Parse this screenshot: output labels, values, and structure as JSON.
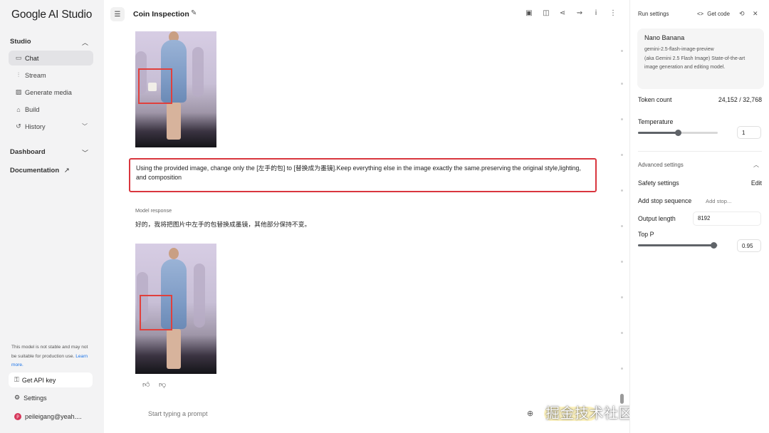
{
  "sidebar": {
    "logo": "Google AI Studio",
    "studio_label": "Studio",
    "items": [
      {
        "label": "Chat",
        "icon": "chat-icon"
      },
      {
        "label": "Stream",
        "icon": "stream-icon"
      },
      {
        "label": "Generate media",
        "icon": "media-icon"
      },
      {
        "label": "Build",
        "icon": "build-icon"
      },
      {
        "label": "History",
        "icon": "history-icon"
      }
    ],
    "dashboard_label": "Dashboard",
    "documentation_label": "Documentation",
    "disclaimer": "This model is not stable and may not be suitable for production use.",
    "learn_more": "Learn more.",
    "api_key_label": "Get API key",
    "settings_label": "Settings",
    "user_label": "peileigang@yeah....",
    "user_initial": "p"
  },
  "header": {
    "title": "Coin Inspection"
  },
  "chat": {
    "prompt_text": "Using the provided image, change only the [左手的包] to [替换成为墨镜].Keep everything else in the image exactly the same.preserving the original style,lighting, and composition",
    "model_label": "Model response",
    "model_text": "好的，我将把图片中左手的包替换成墨镜，其他部分保持不变。",
    "input_placeholder": "Start typing a prompt",
    "watermark": "掘金技术社区 @ 阿念AIGC"
  },
  "run_settings": {
    "title": "Run settings",
    "get_code": "Get code",
    "model_name": "Nano Banana",
    "model_desc_1": "gemini-2.5-flash-image-preview",
    "model_desc_2": "(aka Gemini 2.5 Flash Image) State-of-the-art image generation and editing model.",
    "token_label": "Token count",
    "token_value": "24,152 / 32,768",
    "temperature_label": "Temperature",
    "temperature_value": "1",
    "temperature_fraction": 0.5,
    "advanced_label": "Advanced settings",
    "safety_label": "Safety settings",
    "safety_edit": "Edit",
    "stop_label": "Add stop sequence",
    "stop_placeholder": "Add stop...",
    "output_label": "Output length",
    "output_value": "8192",
    "topp_label": "Top P",
    "topp_value": "0.95",
    "topp_fraction": 0.95
  }
}
